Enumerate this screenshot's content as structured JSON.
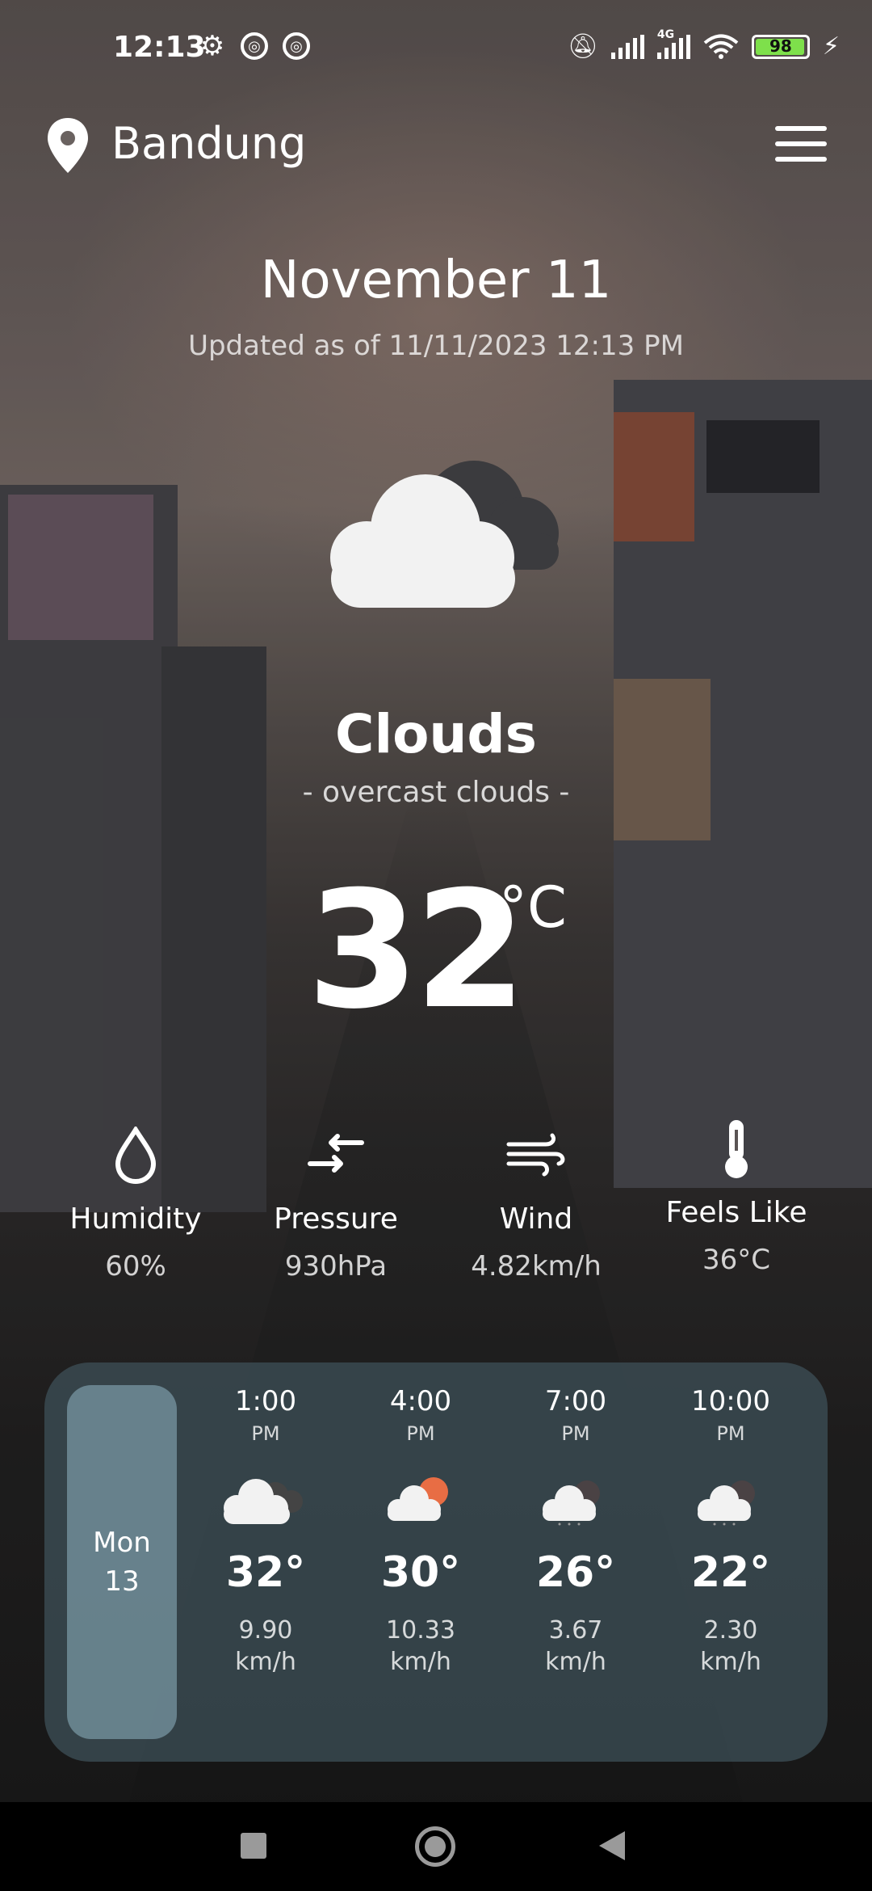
{
  "status_bar": {
    "time": "12:13",
    "battery": "98",
    "network": "4G",
    "battery_color": "#7ee04b"
  },
  "header": {
    "city": "Bandung",
    "location_icon": "map-pin-icon",
    "menu_icon": "hamburger-menu-icon"
  },
  "date": "November 11",
  "updated": "Updated as of 11/11/2023 12:13 PM",
  "current": {
    "icon": "cloud-icon",
    "condition": "Clouds",
    "description": "- overcast clouds -",
    "temperature": "32",
    "unit": "°C"
  },
  "stats": [
    {
      "label": "Humidity",
      "value": "60%",
      "icon": "water-drop-icon"
    },
    {
      "label": "Pressure",
      "value": "930hPa",
      "icon": "pressure-arrows-icon"
    },
    {
      "label": "Wind",
      "value": "4.82km/h",
      "icon": "wind-icon"
    },
    {
      "label": "Feels Like",
      "value": "36°C",
      "icon": "thermometer-icon"
    }
  ],
  "forecast": {
    "day_name": "Mon",
    "day_number": "13",
    "hours": [
      {
        "time": "1:00",
        "ampm": "PM",
        "temp": "32°",
        "speed": "9.90",
        "unit": "km/h",
        "icon": "cloud-icon"
      },
      {
        "time": "4:00",
        "ampm": "PM",
        "temp": "30°",
        "speed": "10.33",
        "unit": "km/h",
        "icon": "sun-cloud-icon"
      },
      {
        "time": "7:00",
        "ampm": "PM",
        "temp": "26°",
        "speed": "3.67",
        "unit": "km/h",
        "icon": "cloud-rain-icon"
      },
      {
        "time": "10:00",
        "ampm": "PM",
        "temp": "22°",
        "speed": "2.30",
        "unit": "km/h",
        "icon": "cloud-rain-icon"
      }
    ]
  }
}
